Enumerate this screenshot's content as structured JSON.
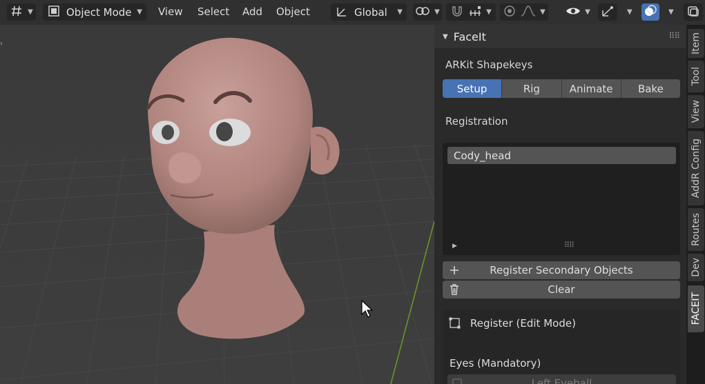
{
  "header": {
    "editor_type_icon": "viewport-editor-icon",
    "mode": "Object Mode",
    "mode_icon": "object-mode-icon",
    "menus": [
      "View",
      "Select",
      "Add",
      "Object"
    ],
    "transform_orientation": "Global",
    "icons": [
      "transform-orientation-icon",
      "pivot-icon",
      "snap-magnet-icon",
      "snap-increment-icon",
      "proportional-edit-icon",
      "falloff-icon",
      "visibility-icon",
      "gizmo-icon",
      "overlay-icon",
      "xray-icon"
    ]
  },
  "colors": {
    "accent": "#4772b3",
    "panel_bg": "#2a2a2a",
    "viewport_bg": "#3b3b3b",
    "head_skin": "#b88a84",
    "grid_line": "#464646",
    "y_axis": "#6b9a26"
  },
  "panel": {
    "title": "FaceIt",
    "section_title": "ARKit Shapekeys",
    "tabs": [
      {
        "label": "Setup",
        "active": true
      },
      {
        "label": "Rig",
        "active": false
      },
      {
        "label": "Animate",
        "active": false
      },
      {
        "label": "Bake",
        "active": false
      }
    ],
    "registration_label": "Registration",
    "registered_objects": [
      "Cody_head"
    ],
    "register_secondary_label": "Register Secondary Objects",
    "clear_label": "Clear",
    "register_edit_mode_label": "Register (Edit Mode)",
    "eyes_label": "Eyes (Mandatory)",
    "left_eyeball_label": "Left Eyeball"
  },
  "side_tabs": [
    {
      "label": "Item",
      "active": false
    },
    {
      "label": "Tool",
      "active": false
    },
    {
      "label": "View",
      "active": false
    },
    {
      "label": "AddR Config",
      "active": false
    },
    {
      "label": "Routes",
      "active": false
    },
    {
      "label": "Dev",
      "active": false
    },
    {
      "label": "FACEIT",
      "active": true
    }
  ]
}
